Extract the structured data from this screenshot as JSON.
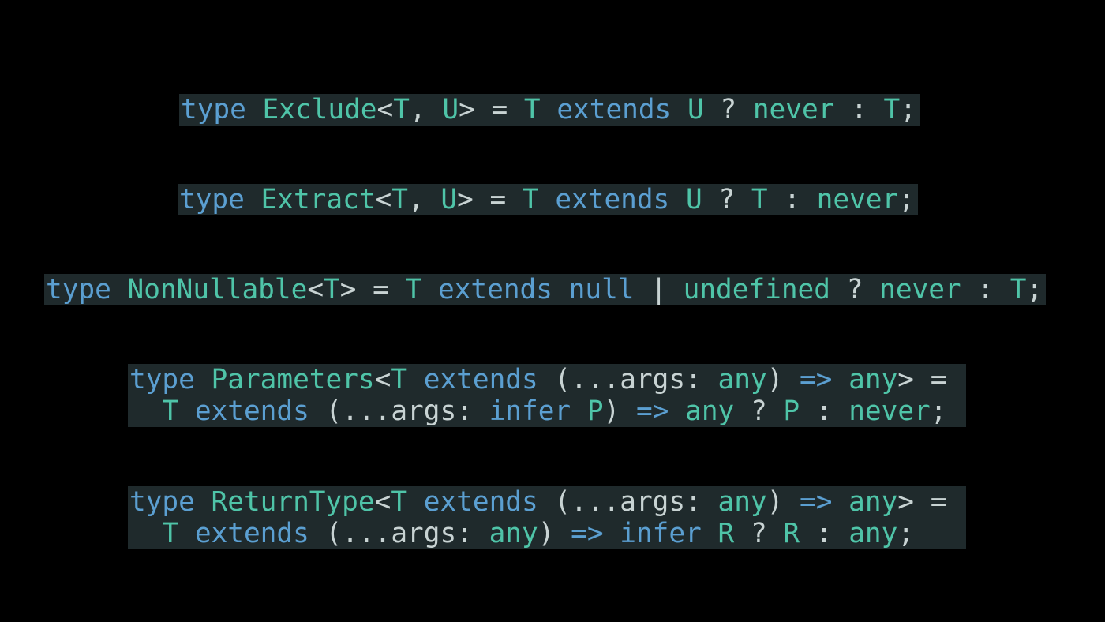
{
  "colors": {
    "background": "#000000",
    "code_background": "#1f2a2c",
    "keyword": "#5b9fd1",
    "type": "#4fc4a8",
    "punctuation": "#c8d3d3"
  },
  "snippets": [
    {
      "lines": [
        [
          [
            "k",
            "type"
          ],
          [
            "p",
            " "
          ],
          [
            "t",
            "Exclude"
          ],
          [
            "p",
            "<"
          ],
          [
            "t",
            "T"
          ],
          [
            "p",
            ", "
          ],
          [
            "t",
            "U"
          ],
          [
            "p",
            "> = "
          ],
          [
            "t",
            "T"
          ],
          [
            "p",
            " "
          ],
          [
            "k",
            "extends"
          ],
          [
            "p",
            " "
          ],
          [
            "t",
            "U"
          ],
          [
            "p",
            " ? "
          ],
          [
            "t",
            "never"
          ],
          [
            "p",
            " : "
          ],
          [
            "t",
            "T"
          ],
          [
            "p",
            ";"
          ]
        ]
      ]
    },
    {
      "lines": [
        [
          [
            "k",
            "type"
          ],
          [
            "p",
            " "
          ],
          [
            "t",
            "Extract"
          ],
          [
            "p",
            "<"
          ],
          [
            "t",
            "T"
          ],
          [
            "p",
            ", "
          ],
          [
            "t",
            "U"
          ],
          [
            "p",
            "> = "
          ],
          [
            "t",
            "T"
          ],
          [
            "p",
            " "
          ],
          [
            "k",
            "extends"
          ],
          [
            "p",
            " "
          ],
          [
            "t",
            "U"
          ],
          [
            "p",
            " ? "
          ],
          [
            "t",
            "T"
          ],
          [
            "p",
            " : "
          ],
          [
            "t",
            "never"
          ],
          [
            "p",
            ";"
          ]
        ]
      ]
    },
    {
      "lines": [
        [
          [
            "k",
            "type"
          ],
          [
            "p",
            " "
          ],
          [
            "t",
            "NonNullable"
          ],
          [
            "p",
            "<"
          ],
          [
            "t",
            "T"
          ],
          [
            "p",
            "> = "
          ],
          [
            "t",
            "T"
          ],
          [
            "p",
            " "
          ],
          [
            "k",
            "extends"
          ],
          [
            "p",
            " "
          ],
          [
            "k",
            "null"
          ],
          [
            "p",
            " | "
          ],
          [
            "t",
            "undefined"
          ],
          [
            "p",
            " ? "
          ],
          [
            "t",
            "never"
          ],
          [
            "p",
            " : "
          ],
          [
            "t",
            "T"
          ],
          [
            "p",
            ";"
          ]
        ]
      ]
    },
    {
      "lines": [
        [
          [
            "k",
            "type"
          ],
          [
            "p",
            " "
          ],
          [
            "t",
            "Parameters"
          ],
          [
            "p",
            "<"
          ],
          [
            "t",
            "T"
          ],
          [
            "p",
            " "
          ],
          [
            "k",
            "extends"
          ],
          [
            "p",
            " (..."
          ],
          [
            "a",
            "args"
          ],
          [
            "p",
            ": "
          ],
          [
            "t",
            "any"
          ],
          [
            "p",
            ") "
          ],
          [
            "k",
            "=>"
          ],
          [
            "p",
            " "
          ],
          [
            "t",
            "any"
          ],
          [
            "p",
            "> = "
          ]
        ],
        [
          [
            "p",
            "  "
          ],
          [
            "t",
            "T"
          ],
          [
            "p",
            " "
          ],
          [
            "k",
            "extends"
          ],
          [
            "p",
            " (..."
          ],
          [
            "a",
            "args"
          ],
          [
            "p",
            ": "
          ],
          [
            "k",
            "infer"
          ],
          [
            "p",
            " "
          ],
          [
            "t",
            "P"
          ],
          [
            "p",
            ") "
          ],
          [
            "k",
            "=>"
          ],
          [
            "p",
            " "
          ],
          [
            "t",
            "any"
          ],
          [
            "p",
            " ? "
          ],
          [
            "t",
            "P"
          ],
          [
            "p",
            " : "
          ],
          [
            "t",
            "never"
          ],
          [
            "p",
            ";"
          ]
        ]
      ]
    },
    {
      "lines": [
        [
          [
            "k",
            "type"
          ],
          [
            "p",
            " "
          ],
          [
            "t",
            "ReturnType"
          ],
          [
            "p",
            "<"
          ],
          [
            "t",
            "T"
          ],
          [
            "p",
            " "
          ],
          [
            "k",
            "extends"
          ],
          [
            "p",
            " (..."
          ],
          [
            "a",
            "args"
          ],
          [
            "p",
            ": "
          ],
          [
            "t",
            "any"
          ],
          [
            "p",
            ") "
          ],
          [
            "k",
            "=>"
          ],
          [
            "p",
            " "
          ],
          [
            "t",
            "any"
          ],
          [
            "p",
            "> = "
          ]
        ],
        [
          [
            "p",
            "  "
          ],
          [
            "t",
            "T"
          ],
          [
            "p",
            " "
          ],
          [
            "k",
            "extends"
          ],
          [
            "p",
            " (..."
          ],
          [
            "a",
            "args"
          ],
          [
            "p",
            ": "
          ],
          [
            "t",
            "any"
          ],
          [
            "p",
            ") "
          ],
          [
            "k",
            "=>"
          ],
          [
            "p",
            " "
          ],
          [
            "k",
            "infer"
          ],
          [
            "p",
            " "
          ],
          [
            "t",
            "R"
          ],
          [
            "p",
            " ? "
          ],
          [
            "t",
            "R"
          ],
          [
            "p",
            " : "
          ],
          [
            "t",
            "any"
          ],
          [
            "p",
            ";"
          ]
        ]
      ]
    }
  ]
}
